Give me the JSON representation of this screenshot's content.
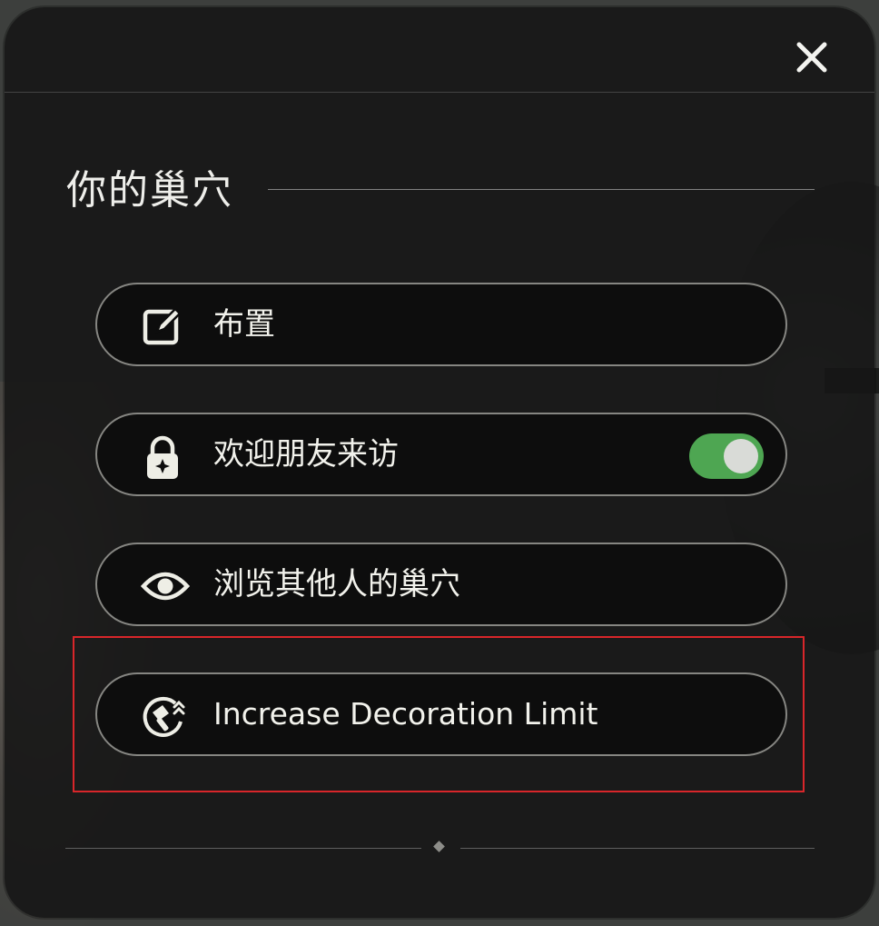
{
  "panel": {
    "section_title": "你的巢穴",
    "close_icon": "close-icon"
  },
  "menu": {
    "items": [
      {
        "icon": "edit-icon",
        "label": "布置"
      },
      {
        "icon": "lock-icon",
        "label": "欢迎朋友来访",
        "toggle_on": true,
        "toggle_color": "#4ea652"
      },
      {
        "icon": "eye-icon",
        "label": "浏览其他人的巢穴"
      },
      {
        "icon": "hammer-upgrade-icon",
        "label": "Increase Decoration Limit",
        "highlighted": true
      }
    ]
  },
  "colors": {
    "panel_bg": "#161616",
    "text": "#f2f2ec",
    "highlight_border": "#d8262a"
  }
}
